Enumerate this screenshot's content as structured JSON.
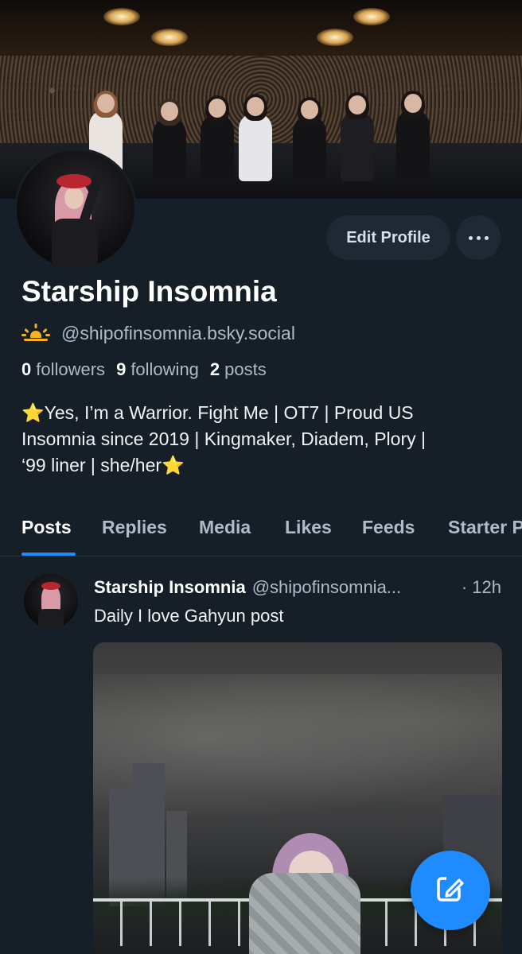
{
  "profile": {
    "display_name": "Starship Insomnia",
    "handle": "@shipofinsomnia.bsky.social",
    "handle_icon": "sunrise-icon",
    "edit_label": "Edit Profile",
    "more_icon": "ellipsis-icon",
    "stats": {
      "followers_count": "0",
      "followers_label": "followers",
      "following_count": "9",
      "following_label": "following",
      "posts_count": "2",
      "posts_label": "posts"
    },
    "bio": {
      "line1": "Yes, I’m a Warrior. Fight Me | OT7 | Proud US",
      "line2": "Insomnia since 2019 | Kingmaker, Diadem, Plory |",
      "line3": "‘99 liner | she/her",
      "star": "⭐"
    }
  },
  "tabs": [
    {
      "label": "Posts",
      "active": true
    },
    {
      "label": "Replies"
    },
    {
      "label": "Media"
    },
    {
      "label": "Likes"
    },
    {
      "label": "Feeds"
    },
    {
      "label": "Starter Packs"
    }
  ],
  "post": {
    "author": "Starship Insomnia",
    "handle": "@shipofinsomnia...",
    "time": "· 12h",
    "text": "Daily I love Gahyun post"
  },
  "fab": {
    "icon": "compose-icon"
  },
  "colors": {
    "background": "#161e27",
    "accent": "#208bfe",
    "button_bg": "#1e2935",
    "muted_text": "#aebbc9"
  }
}
